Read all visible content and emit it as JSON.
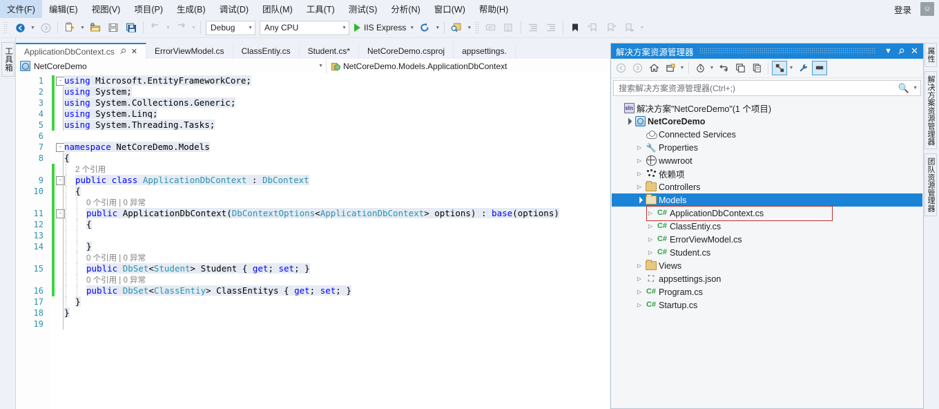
{
  "menu": {
    "items": [
      {
        "label": "文件(F)"
      },
      {
        "label": "编辑(E)"
      },
      {
        "label": "视图(V)"
      },
      {
        "label": "项目(P)"
      },
      {
        "label": "生成(B)"
      },
      {
        "label": "调试(D)"
      },
      {
        "label": "团队(M)"
      },
      {
        "label": "工具(T)"
      },
      {
        "label": "测试(S)"
      },
      {
        "label": "分析(N)"
      },
      {
        "label": "窗口(W)"
      },
      {
        "label": "帮助(H)"
      }
    ],
    "signin_label": "登录",
    "feedback_icon": "feedback-smiley-icon"
  },
  "toolbar": {
    "nav_back_icon": "navigate-back-icon",
    "nav_forward_icon": "navigate-forward-icon",
    "new_project_icon": "new-project-icon",
    "open_file_icon": "open-file-icon",
    "save_icon": "save-icon",
    "save_all_icon": "save-all-icon",
    "undo_icon": "undo-icon",
    "redo_icon": "redo-icon",
    "config_value": "Debug",
    "platform_value": "Any CPU",
    "run_label": "IIS Express",
    "refresh_icon": "refresh-icon",
    "find_icon": "find-in-files-icon",
    "comment_icon": "comment-selection-icon",
    "uncomment_icon": "uncomment-selection-icon",
    "indent_decrease_icon": "decrease-indent-icon",
    "indent_increase_icon": "increase-indent-icon",
    "bookmark_icon": "bookmark-icon",
    "bookmark_prev_icon": "previous-bookmark-icon",
    "bookmark_next_icon": "next-bookmark-icon",
    "bookmark_clear_icon": "clear-bookmarks-icon",
    "overflow_icon": "toolbar-overflow-icon"
  },
  "left_rail": {
    "toolbox_label": "工具箱"
  },
  "right_rail": {
    "tabs": [
      {
        "label": "属性"
      },
      {
        "label": "解决方案资源管理器"
      },
      {
        "label": "团队资源管理器"
      }
    ]
  },
  "editor_tabs": [
    {
      "label": "ApplicationDbContext.cs",
      "active": true,
      "pin_icon": "pin-icon",
      "close_icon": "close-icon"
    },
    {
      "label": "ErrorViewModel.cs",
      "active": false
    },
    {
      "label": "ClassEntiy.cs",
      "active": false
    },
    {
      "label": "Student.cs*",
      "active": false
    },
    {
      "label": "NetCoreDemo.csproj",
      "active": false
    },
    {
      "label": "appsettings.",
      "active": false
    }
  ],
  "navbar": {
    "project_icon": "project-icon",
    "project_value": "NetCoreDemo",
    "member_icon": "class-icon",
    "member_value": "NetCoreDemo.Models.ApplicationDbContext"
  },
  "code": {
    "lines": [
      {
        "n": "1",
        "indent": 0,
        "glyph": "-",
        "change": "green",
        "hl": true,
        "tokens": [
          {
            "t": "using ",
            "c": "k"
          },
          {
            "t": "Microsoft.EntityFrameworkCore;",
            "c": "p"
          }
        ]
      },
      {
        "n": "2",
        "indent": 0,
        "glyph": "",
        "change": "green",
        "hl": true,
        "tokens": [
          {
            "t": "using ",
            "c": "k"
          },
          {
            "t": "System;",
            "c": "p"
          }
        ]
      },
      {
        "n": "3",
        "indent": 0,
        "glyph": "",
        "change": "green",
        "hl": true,
        "tokens": [
          {
            "t": "using ",
            "c": "k"
          },
          {
            "t": "System.Collections.Generic;",
            "c": "p"
          }
        ]
      },
      {
        "n": "4",
        "indent": 0,
        "glyph": "",
        "change": "green",
        "hl": true,
        "tokens": [
          {
            "t": "using ",
            "c": "k"
          },
          {
            "t": "System.Linq;",
            "c": "p"
          }
        ]
      },
      {
        "n": "5",
        "indent": 0,
        "glyph": "",
        "change": "green",
        "hl": true,
        "tokens": [
          {
            "t": "using ",
            "c": "k"
          },
          {
            "t": "System.Threading.Tasks;",
            "c": "p"
          }
        ]
      },
      {
        "n": "6",
        "indent": 0,
        "glyph": "",
        "change": "",
        "hl": false,
        "tokens": []
      },
      {
        "n": "7",
        "indent": 0,
        "glyph": "-",
        "change": "",
        "hl": true,
        "tokens": [
          {
            "t": "namespace ",
            "c": "k"
          },
          {
            "t": "NetCoreDemo.Models",
            "c": "p"
          }
        ]
      },
      {
        "n": "8",
        "indent": 0,
        "glyph": "",
        "change": "",
        "hl": true,
        "tokens": [
          {
            "t": "{",
            "c": "p"
          }
        ]
      },
      {
        "n": "",
        "indent": 1,
        "glyph": "",
        "change": "green",
        "hl": false,
        "codelens": "2 个引用"
      },
      {
        "n": "9",
        "indent": 1,
        "glyph": "-",
        "change": "green",
        "hl": true,
        "tokens": [
          {
            "t": "public class ",
            "c": "k"
          },
          {
            "t": "ApplicationDbContext",
            "c": "t"
          },
          {
            "t": " : ",
            "c": "p"
          },
          {
            "t": "DbContext",
            "c": "t"
          }
        ]
      },
      {
        "n": "10",
        "indent": 1,
        "glyph": "",
        "change": "green",
        "hl": true,
        "tokens": [
          {
            "t": "{",
            "c": "p"
          }
        ]
      },
      {
        "n": "",
        "indent": 2,
        "glyph": "",
        "change": "green",
        "hl": false,
        "codelens": "0 个引用 | 0 异常"
      },
      {
        "n": "11",
        "indent": 2,
        "glyph": "-",
        "change": "green",
        "hl": true,
        "tokens": [
          {
            "t": "public ",
            "c": "k"
          },
          {
            "t": "ApplicationDbContext(",
            "c": "p"
          },
          {
            "t": "DbContextOptions",
            "c": "t"
          },
          {
            "t": "<",
            "c": "p"
          },
          {
            "t": "ApplicationDbContext",
            "c": "t"
          },
          {
            "t": "> options) : ",
            "c": "p"
          },
          {
            "t": "base",
            "c": "k"
          },
          {
            "t": "(options)",
            "c": "p"
          }
        ]
      },
      {
        "n": "12",
        "indent": 2,
        "glyph": "",
        "change": "green",
        "hl": true,
        "tokens": [
          {
            "t": "{",
            "c": "p"
          }
        ]
      },
      {
        "n": "13",
        "indent": 2,
        "glyph": "",
        "change": "green",
        "hl": false,
        "tokens": []
      },
      {
        "n": "14",
        "indent": 2,
        "glyph": "",
        "change": "green",
        "hl": true,
        "tokens": [
          {
            "t": "}",
            "c": "p"
          }
        ]
      },
      {
        "n": "",
        "indent": 2,
        "glyph": "",
        "change": "green",
        "hl": false,
        "codelens": "0 个引用 | 0 异常"
      },
      {
        "n": "15",
        "indent": 2,
        "glyph": "",
        "change": "green",
        "hl": true,
        "tokens": [
          {
            "t": "public ",
            "c": "k"
          },
          {
            "t": "DbSet",
            "c": "t"
          },
          {
            "t": "<",
            "c": "p"
          },
          {
            "t": "Student",
            "c": "t"
          },
          {
            "t": "> Student { ",
            "c": "p"
          },
          {
            "t": "get",
            "c": "k"
          },
          {
            "t": "; ",
            "c": "p"
          },
          {
            "t": "set",
            "c": "k"
          },
          {
            "t": "; }",
            "c": "p"
          }
        ]
      },
      {
        "n": "",
        "indent": 2,
        "glyph": "",
        "change": "green",
        "hl": false,
        "codelens": "0 个引用 | 0 异常"
      },
      {
        "n": "16",
        "indent": 2,
        "glyph": "",
        "change": "green",
        "hl": true,
        "tokens": [
          {
            "t": "public ",
            "c": "k"
          },
          {
            "t": "DbSet",
            "c": "t"
          },
          {
            "t": "<",
            "c": "p"
          },
          {
            "t": "ClassEntiy",
            "c": "t"
          },
          {
            "t": "> ClassEntitys { ",
            "c": "p"
          },
          {
            "t": "get",
            "c": "k"
          },
          {
            "t": "; ",
            "c": "p"
          },
          {
            "t": "set",
            "c": "k"
          },
          {
            "t": "; }",
            "c": "p"
          }
        ]
      },
      {
        "n": "17",
        "indent": 1,
        "glyph": "",
        "change": "",
        "hl": true,
        "tokens": [
          {
            "t": "}",
            "c": "p"
          }
        ]
      },
      {
        "n": "18",
        "indent": 0,
        "glyph": "",
        "change": "",
        "hl": true,
        "tokens": [
          {
            "t": "}",
            "c": "p"
          }
        ]
      },
      {
        "n": "19",
        "indent": 0,
        "glyph": "",
        "change": "",
        "hl": false,
        "tokens": []
      }
    ]
  },
  "solution_explorer": {
    "title": "解决方案资源管理器",
    "title_menu_icon": "chevron-down-icon",
    "title_pin_icon": "pin-icon",
    "title_close_icon": "close-icon",
    "toolbar": {
      "back_icon": "back-icon",
      "forward_icon": "forward-icon",
      "home_icon": "home-icon",
      "scope_icon": "sync-with-active-document-icon",
      "pending_changes_icon": "pending-changes-filter-icon",
      "refresh_icon": "refresh-icon",
      "collapse_all_icon": "collapse-all-icon",
      "show_all_files_icon": "show-all-files-icon",
      "preview_icon": "preview-selected-items-icon",
      "properties_icon": "properties-wrench-icon",
      "properties_window_icon": "properties-window-icon"
    },
    "search_placeholder": "搜索解决方案资源管理器(Ctrl+;)",
    "search_icon": "search-magnifier-icon",
    "search_dropdown_icon": "chevron-down-icon",
    "tree": [
      {
        "label": "解决方案\"NetCoreDemo\"(1 个项目)",
        "depth": 0,
        "icon": "solution-icon",
        "expander": "",
        "bold": false,
        "selected": false
      },
      {
        "label": "NetCoreDemo",
        "depth": 1,
        "icon": "web-project-icon",
        "expander": "▲",
        "bold": true,
        "selected": false
      },
      {
        "label": "Connected Services",
        "depth": 2,
        "icon": "cloud-icon",
        "expander": "",
        "bold": false,
        "selected": false
      },
      {
        "label": "Properties",
        "depth": 2,
        "icon": "wrench-icon",
        "expander": "▷",
        "bold": false,
        "selected": false
      },
      {
        "label": "wwwroot",
        "depth": 2,
        "icon": "globe-icon",
        "expander": "▷",
        "bold": false,
        "selected": false
      },
      {
        "label": "依赖项",
        "depth": 2,
        "icon": "dependencies-icon",
        "expander": "▷",
        "bold": false,
        "selected": false
      },
      {
        "label": "Controllers",
        "depth": 2,
        "icon": "folder-icon",
        "expander": "▷",
        "bold": false,
        "selected": false
      },
      {
        "label": "Models",
        "depth": 2,
        "icon": "folder-open-icon",
        "expander": "▲",
        "bold": false,
        "selected": true
      },
      {
        "label": "ApplicationDbContext.cs",
        "depth": 3,
        "icon": "csharp-file-icon",
        "expander": "▷",
        "bold": false,
        "selected": false,
        "highlight_box": true
      },
      {
        "label": "ClassEntiy.cs",
        "depth": 3,
        "icon": "csharp-file-icon",
        "expander": "▷",
        "bold": false,
        "selected": false
      },
      {
        "label": "ErrorViewModel.cs",
        "depth": 3,
        "icon": "csharp-file-icon",
        "expander": "▷",
        "bold": false,
        "selected": false
      },
      {
        "label": "Student.cs",
        "depth": 3,
        "icon": "csharp-file-icon",
        "expander": "▷",
        "bold": false,
        "selected": false
      },
      {
        "label": "Views",
        "depth": 2,
        "icon": "folder-icon",
        "expander": "▷",
        "bold": false,
        "selected": false
      },
      {
        "label": "appsettings.json",
        "depth": 2,
        "icon": "json-file-icon",
        "expander": "▷",
        "bold": false,
        "selected": false
      },
      {
        "label": "Program.cs",
        "depth": 2,
        "icon": "csharp-file-icon",
        "expander": "▷",
        "bold": false,
        "selected": false
      },
      {
        "label": "Startup.cs",
        "depth": 2,
        "icon": "csharp-file-icon",
        "expander": "▷",
        "bold": false,
        "selected": false
      }
    ]
  },
  "colors": {
    "accent": "#1b84d6",
    "selection": "#1b84d6",
    "keyword": "#0000ff",
    "type": "#2b91af",
    "codelens": "#808080",
    "change_bar": "#3fd43f",
    "highlight_box": "#c0302b",
    "chrome": "#eef1f7"
  }
}
